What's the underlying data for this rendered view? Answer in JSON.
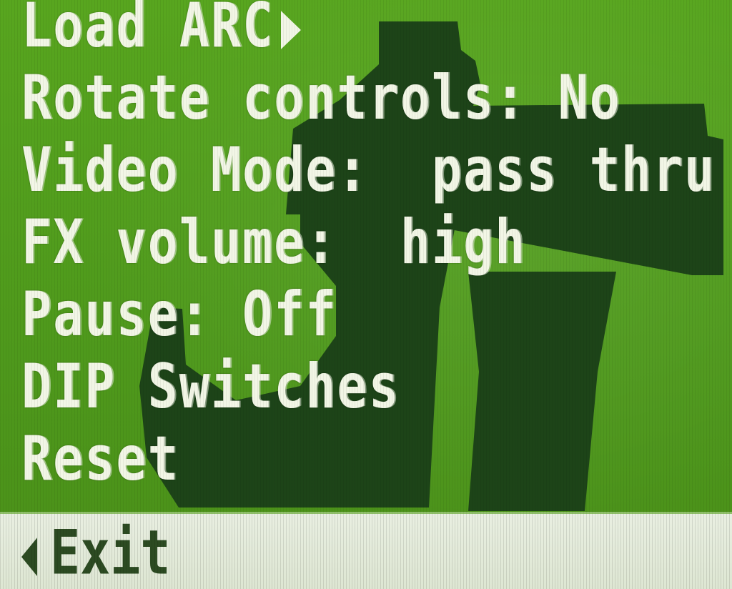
{
  "menu": {
    "items": [
      {
        "label": "Load ARC",
        "has_submenu": true
      },
      {
        "label": "Rotate controls: No"
      },
      {
        "label": "Video Mode:  pass thru"
      },
      {
        "label": "FX volume:  high"
      },
      {
        "label": "Pause: Off"
      },
      {
        "label": "DIP Switches"
      },
      {
        "label": "Reset"
      }
    ]
  },
  "footer": {
    "exit_label": "Exit",
    "icon": "back-arrow-icon"
  },
  "colors": {
    "background_green": "#52a01e",
    "logo_dark_green": "#1d4418",
    "menu_text": "#f2f6e6",
    "footer_bar": "#e4ebdc",
    "footer_text": "#2c4b22"
  },
  "background_logo": "dark-green-logo-icon"
}
